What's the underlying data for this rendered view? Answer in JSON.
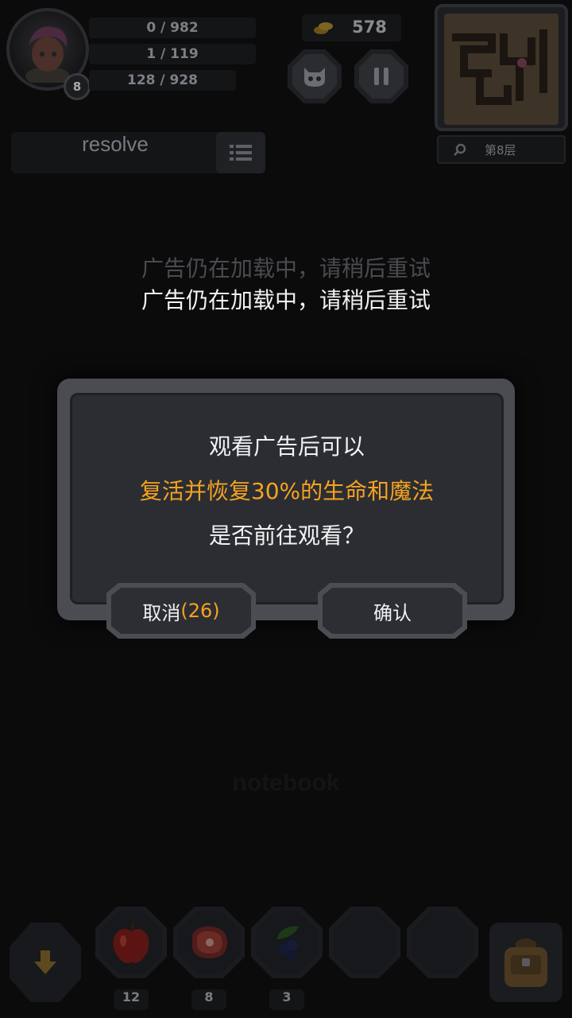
{
  "player": {
    "level": "8",
    "stat1": "0 / 982",
    "stat2": "1 / 119",
    "stat3": "128 / 928"
  },
  "coins": "578",
  "floor_label": "第8层",
  "search": {
    "value": "resolve"
  },
  "toasts": [
    "广告仍在加载中，请稍后重试",
    "广告仍在加载中，请稍后重试"
  ],
  "dialog": {
    "line1": "观看广告后可以",
    "line2": "复活并恢复30%的生命和魔法",
    "line3": "是否前往观看？",
    "cancel_label": "取消",
    "cancel_countdown": "(26)",
    "confirm_label": "确认"
  },
  "background_text": "notebook",
  "inventory": {
    "items": [
      {
        "icon": "apple-icon",
        "count": "12"
      },
      {
        "icon": "meat-icon",
        "count": "8"
      },
      {
        "icon": "berries-icon",
        "count": "3"
      },
      {
        "icon": "",
        "count": ""
      },
      {
        "icon": "",
        "count": ""
      }
    ]
  },
  "colors": {
    "highlight": "#f5a31f",
    "countdown": "#f5a31f",
    "white_text": "#f2f2f2"
  }
}
